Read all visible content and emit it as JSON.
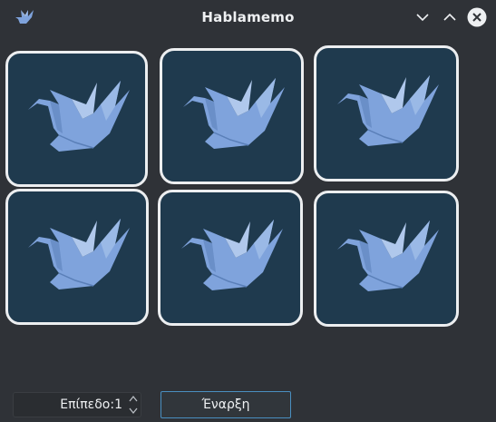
{
  "window": {
    "title": "Hablamemo",
    "icon": "paper-crane-icon",
    "controls": [
      "minimize-icon",
      "maximize-icon",
      "close-icon"
    ]
  },
  "board": {
    "card_back_icon": "paper-crane-icon",
    "card_colors": {
      "background": "#1f3a4e",
      "border": "#eceef0",
      "crane": "#7fa3dc",
      "crane_light": "#b0c8ec"
    },
    "cards": [
      {
        "row": 1,
        "col": 1,
        "face": "hidden"
      },
      {
        "row": 1,
        "col": 2,
        "face": "hidden"
      },
      {
        "row": 1,
        "col": 3,
        "face": "hidden"
      },
      {
        "row": 2,
        "col": 1,
        "face": "hidden"
      },
      {
        "row": 2,
        "col": 2,
        "face": "hidden"
      },
      {
        "row": 2,
        "col": 3,
        "face": "hidden"
      }
    ]
  },
  "controls": {
    "level_text": "Επίπεδο:1",
    "start_label": "Έναρξη"
  }
}
